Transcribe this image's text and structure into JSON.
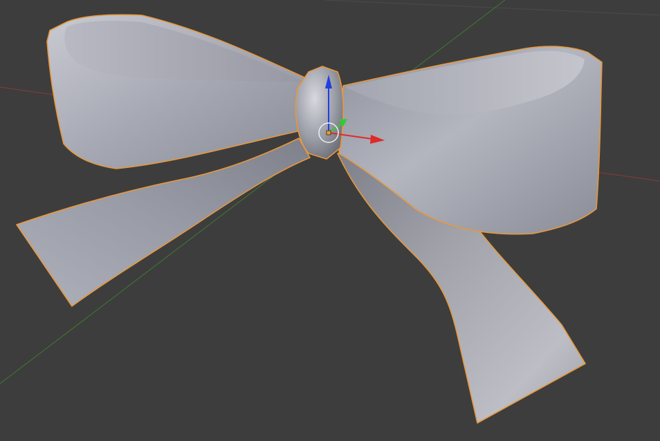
{
  "viewport": {
    "background": "#3d3d3d",
    "grid_line_color": "#4a4a4a",
    "x_axis_color": "#8a3a3a",
    "y_axis_color": "#3f7a2f"
  },
  "object": {
    "name_visible": false,
    "selected": true,
    "outline_color": "#e8983a",
    "material_color": "#9c9ea8"
  },
  "gizmo": {
    "type": "translate-manipulator",
    "x_arrow_color": "#e02a2a",
    "y_arrow_color": "#2fcf2f",
    "z_arrow_color": "#1f3fe0",
    "origin_color": "#e8983a",
    "pivot_ring_color": "#f0f0f0"
  }
}
